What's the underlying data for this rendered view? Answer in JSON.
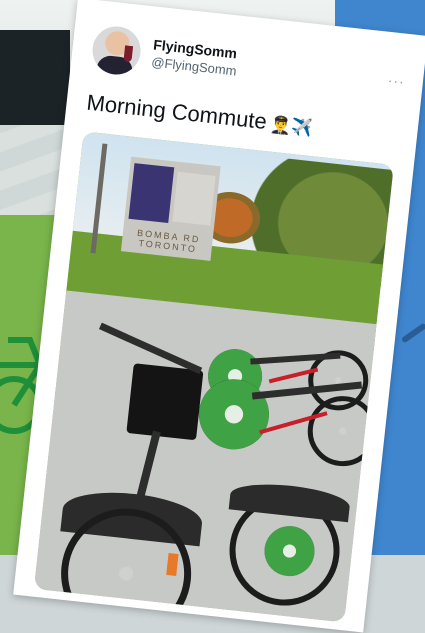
{
  "tweet": {
    "display_name": "FlyingSomm",
    "handle": "@FlyingSomm",
    "more_label": "···",
    "text": "Morning Commute",
    "emojis": "👨‍✈️✈️"
  },
  "photo": {
    "sign_text": "BOMBA RD TORONTO"
  },
  "colors": {
    "bike_share_green": "#3fa244",
    "frame_red": "#c8202a",
    "background_blue": "#3f86cf",
    "background_green": "#79b54a"
  }
}
